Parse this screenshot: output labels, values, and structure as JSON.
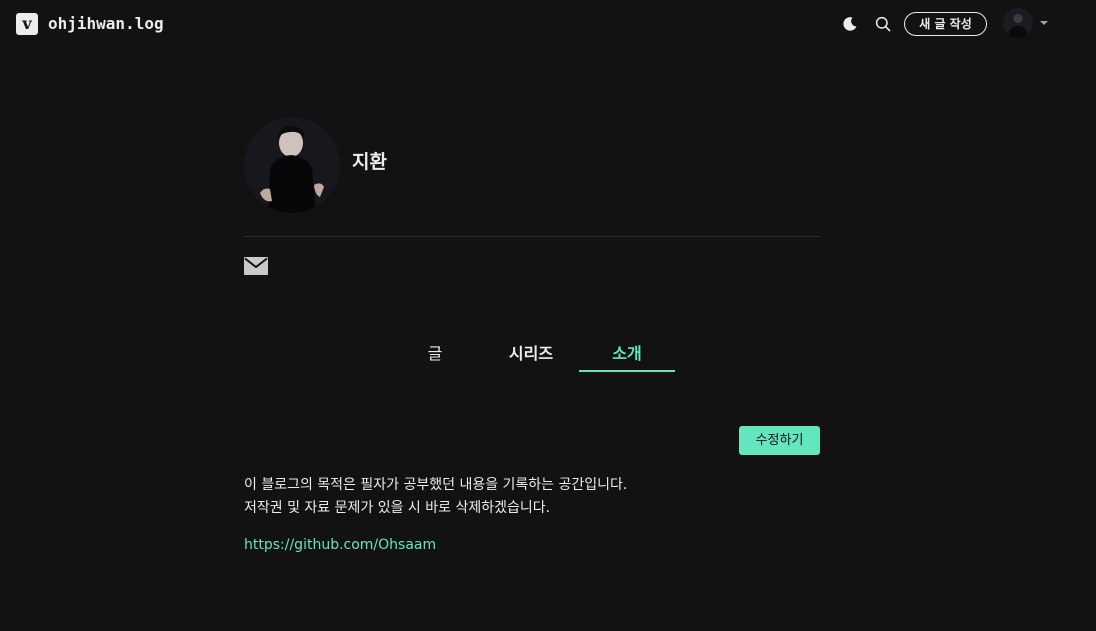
{
  "header": {
    "logo_letter": "v",
    "blog_title": "ohjihwan.log",
    "theme_icon": "moon-icon",
    "search_icon": "search-icon",
    "write_button_label": "새 글 작성",
    "avatar_icon": "user-avatar",
    "menu_icon": "caret-down-icon"
  },
  "profile": {
    "name": "지환",
    "avatar_icon": "profile-photo",
    "contact_icon": "mail-icon"
  },
  "tabs": [
    {
      "label": "글",
      "active": false
    },
    {
      "label": "시리즈",
      "active": false
    },
    {
      "label": "소개",
      "active": true
    }
  ],
  "about": {
    "edit_button_label": "수정하기",
    "lines": [
      "이 블로그의 목적은 필자가 공부했던 내용을 기록하는 공간입니다.",
      "저작권 및 자료 문제가 있을 시 바로 삭제하겠습니다."
    ],
    "link": "https://github.com/Ohsaam"
  },
  "colors": {
    "background": "#121212",
    "text": "#ececec",
    "accent": "#63e6be",
    "divider": "#2e2e2e"
  }
}
